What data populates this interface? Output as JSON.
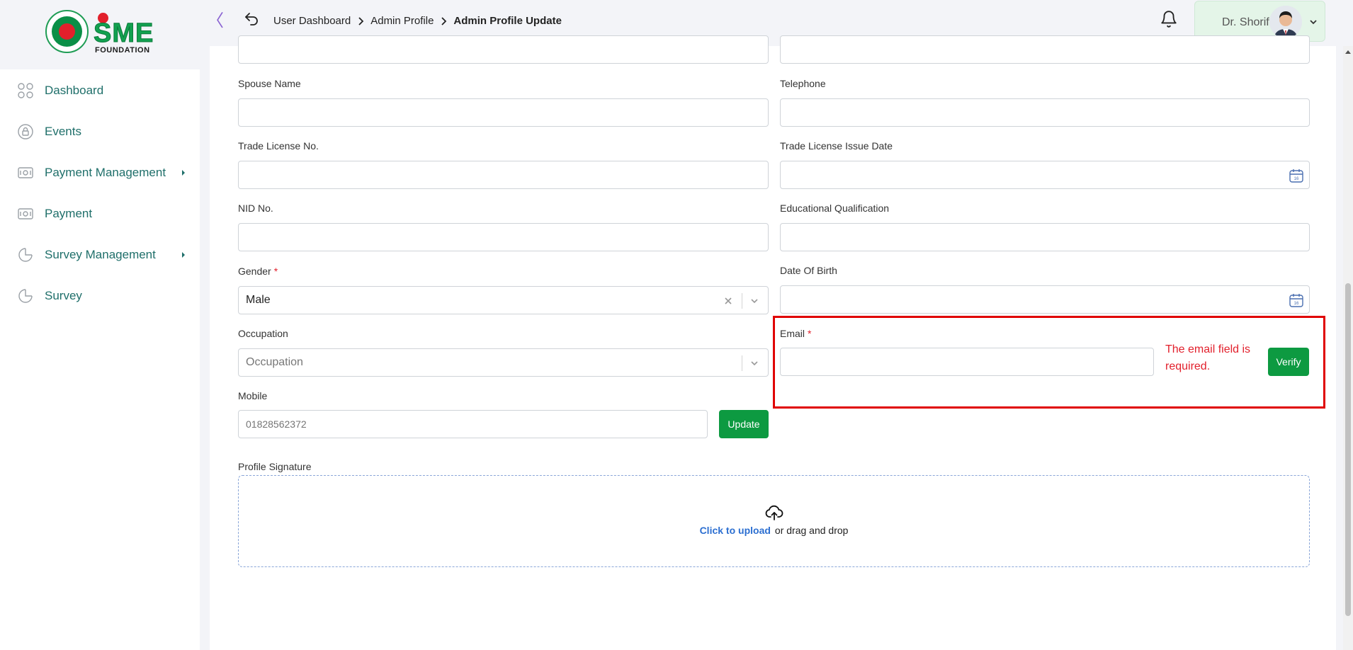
{
  "brand": {
    "word": "SME",
    "sub": "FOUNDATION"
  },
  "header": {
    "breadcrumb": [
      "User Dashboard",
      "Admin Profile",
      "Admin Profile Update"
    ],
    "user_name": "Dr. Shorif"
  },
  "sidebar": {
    "items": [
      {
        "label": "Dashboard",
        "icon": "grid-icon",
        "has_submenu": false
      },
      {
        "label": "Events",
        "icon": "lock-icon",
        "has_submenu": false
      },
      {
        "label": "Payment Management",
        "icon": "money-icon",
        "has_submenu": true
      },
      {
        "label": "Payment",
        "icon": "money-icon",
        "has_submenu": false
      },
      {
        "label": "Survey Management",
        "icon": "pie-chart-icon",
        "has_submenu": true
      },
      {
        "label": "Survey",
        "icon": "pie-chart-icon",
        "has_submenu": false
      }
    ]
  },
  "form": {
    "spouse_name": {
      "label": "Spouse Name",
      "value": ""
    },
    "telephone": {
      "label": "Telephone",
      "value": ""
    },
    "trade_license_no": {
      "label": "Trade License No.",
      "value": ""
    },
    "trade_license_issue_date": {
      "label": "Trade License Issue Date",
      "value": ""
    },
    "nid_no": {
      "label": "NID No.",
      "value": ""
    },
    "educational_qualification": {
      "label": "Educational Qualification",
      "value": ""
    },
    "gender": {
      "label": "Gender",
      "required_mark": "*",
      "value": "Male"
    },
    "date_of_birth": {
      "label": "Date Of Birth",
      "value": ""
    },
    "occupation": {
      "label": "Occupation",
      "placeholder": "Occupation"
    },
    "email": {
      "label": "Email",
      "required_mark": "*",
      "value": "",
      "error_line1": "The email field is",
      "error_line2": "required.",
      "verify_label": "Verify"
    },
    "mobile": {
      "label": "Mobile",
      "placeholder": "01828562372",
      "update_label": "Update"
    },
    "profile_signature": {
      "label": "Profile Signature",
      "upload_link": "Click to upload",
      "upload_text": "or drag and drop"
    }
  },
  "colors": {
    "accent_green": "#0d9a41",
    "error_red": "#e2202c",
    "sidebar_text": "#1f6f6a",
    "link_blue": "#2c6fd1"
  }
}
